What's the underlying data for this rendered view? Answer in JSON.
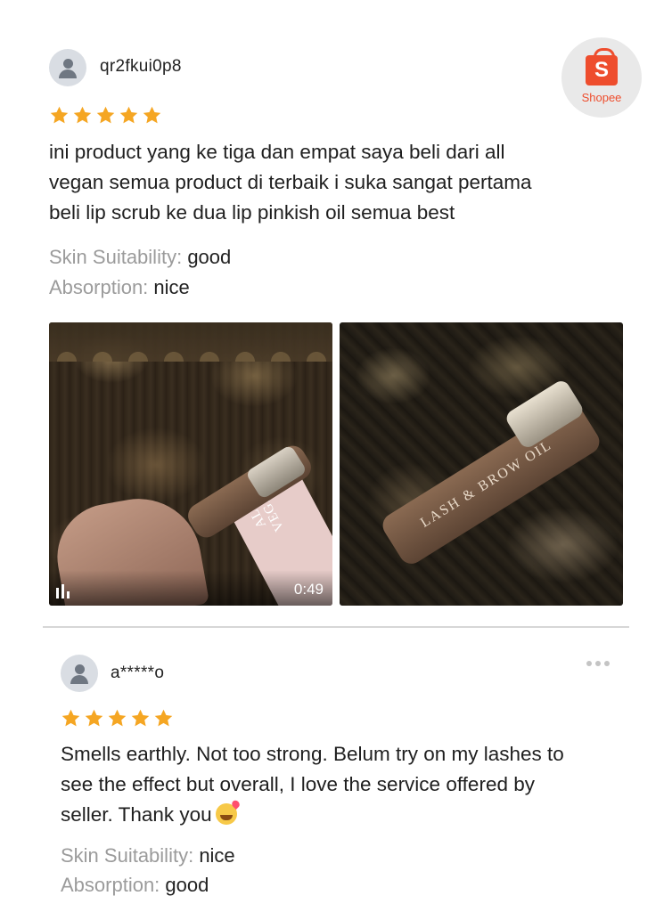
{
  "reviews": [
    {
      "username": "qr2fkui0p8",
      "rating": 5,
      "text_lines": [
        "ini product yang ke  tiga dan empat saya beli dari all",
        "vegan semua product di terbaik i suka sangat pertama",
        "beli lip scrub ke dua lip pinkish oil semua best"
      ],
      "attributes": [
        {
          "label": "Skin Suitability:",
          "value": "good"
        },
        {
          "label": "Absorption:",
          "value": "nice"
        }
      ],
      "media": [
        {
          "type": "video",
          "duration": "0:49",
          "printed_text": [
            "ALL",
            "VEGAN"
          ]
        },
        {
          "type": "image",
          "printed_text": [
            "LASH & BROW OIL"
          ]
        }
      ]
    },
    {
      "username": "a*****o",
      "rating": 5,
      "text_lines": [
        "Smells earthly. Not too strong. Belum try on my lashes to",
        "see the effect but overall, I love the service offered by",
        "seller. Thank you"
      ],
      "emoji": "smiling-face-with-hearts",
      "attributes": [
        {
          "label": "Skin Suitability:",
          "value": "nice"
        },
        {
          "label": "Absorption:",
          "value": "good"
        }
      ]
    }
  ],
  "shopee_badge": {
    "letter": "S",
    "label": "Shopee"
  },
  "colors": {
    "star": "#f5a623",
    "brand": "#ee4d2d",
    "label_gray": "#9b9b9b"
  },
  "icons": {
    "avatar": "user-avatar-icon",
    "star": "star-icon",
    "more": "more-options-icon",
    "video": "video-indicator-icon"
  }
}
